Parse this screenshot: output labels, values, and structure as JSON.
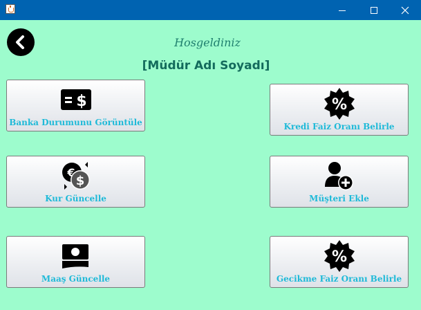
{
  "window": {
    "title": ""
  },
  "header": {
    "welcome": "Hosgeldiniz",
    "manager_name": "[Müdür Adı Soyadı]"
  },
  "buttons": {
    "bank_status": "Banka Durumunu Görüntüle",
    "loan_rate": "Kredi Faiz Oranı Belirle",
    "update_rate": "Kur Güncelle",
    "add_customer": "Müşteri Ekle",
    "update_salary": "Maaş Güncelle",
    "late_rate": "Gecikme Faiz Oranı Belirle"
  },
  "colors": {
    "background": "#9dfccd",
    "titlebar": "#0063b1",
    "button_label": "#1fbad8",
    "heading": "#136b5c"
  },
  "icons": {
    "bank_status": "money-bill-dollar-icon",
    "loan_rate": "percent-badge-icon",
    "update_rate": "currency-exchange-icon",
    "add_customer": "user-plus-icon",
    "update_salary": "money-bill-icon",
    "late_rate": "percent-badge-icon"
  }
}
